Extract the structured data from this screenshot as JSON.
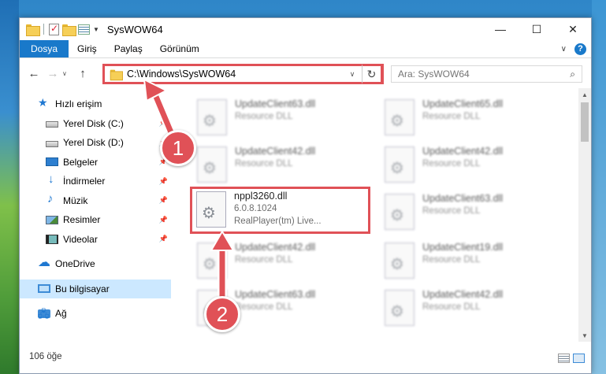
{
  "window": {
    "title": "SysWOW64",
    "controls": {
      "minimize": "—",
      "maximize": "☐",
      "close": "✕"
    }
  },
  "ribbon": {
    "tabs": [
      "Dosya",
      "Giriş",
      "Paylaş",
      "Görünüm"
    ],
    "help_icon": "?"
  },
  "address": {
    "path": "C:\\Windows\\SysWOW64",
    "search_placeholder": "Ara: SysWOW64"
  },
  "sidebar": {
    "items": [
      {
        "label": "Hızlı erişim",
        "icon": "star-icon"
      },
      {
        "label": "Yerel Disk (C:)",
        "icon": "disk-icon",
        "pinned": true
      },
      {
        "label": "Yerel Disk (D:)",
        "icon": "disk-icon",
        "pinned": true
      },
      {
        "label": "Belgeler",
        "icon": "document-icon",
        "pinned": true
      },
      {
        "label": "İndirmeler",
        "icon": "download-icon",
        "pinned": true
      },
      {
        "label": "Müzik",
        "icon": "music-icon",
        "pinned": true
      },
      {
        "label": "Resimler",
        "icon": "pictures-icon",
        "pinned": true
      },
      {
        "label": "Videolar",
        "icon": "video-icon",
        "pinned": true
      },
      {
        "label": "OneDrive",
        "icon": "cloud-icon"
      },
      {
        "label": "Bu bilgisayar",
        "icon": "pc-icon",
        "selected": true
      },
      {
        "label": "Ağ",
        "icon": "network-icon"
      }
    ]
  },
  "files": {
    "left_column": [
      {
        "name": "UpdateClient63.dll",
        "sub": "Resource DLL"
      },
      {
        "name": "UpdateClient42.dll",
        "sub": "Resource DLL"
      },
      {
        "name": "nppl3260.dll",
        "sub": "6.0.8.1024",
        "sub2": "RealPlayer(tm) Live..."
      },
      {
        "name": "UpdateClient42.dll",
        "sub": "Resource DLL"
      },
      {
        "name": "UpdateClient63.dll",
        "sub": "Resource DLL"
      }
    ],
    "right_column": [
      {
        "name": "UpdateClient65.dll",
        "sub": "Resource DLL"
      },
      {
        "name": "UpdateClient42.dll",
        "sub": "Resource DLL"
      },
      {
        "name": "UpdateClient63.dll",
        "sub": "Resource DLL"
      },
      {
        "name": "UpdateClient19.dll",
        "sub": "Resource DLL"
      },
      {
        "name": "UpdateClient42.dll",
        "sub": "Resource DLL"
      }
    ]
  },
  "status": {
    "count": "106 öğe"
  },
  "annotations": {
    "badge1": "1",
    "badge2": "2"
  },
  "colors": {
    "accent": "#1979ca",
    "highlight": "#e05157",
    "selection": "#cce8ff"
  }
}
